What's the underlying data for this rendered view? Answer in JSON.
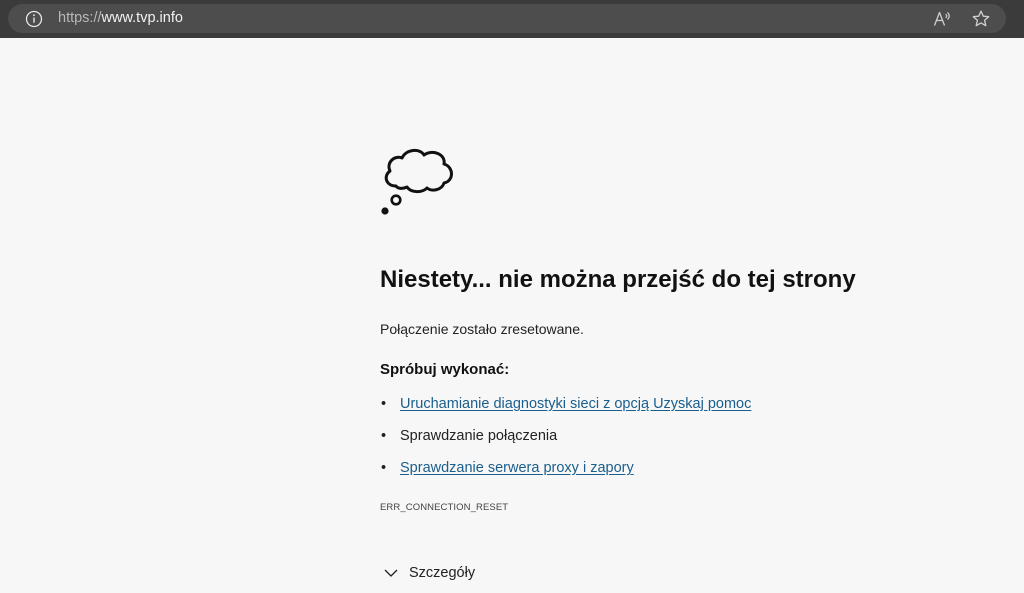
{
  "addressbar": {
    "url_scheme": "https://",
    "url_host": "www.tvp.info"
  },
  "error": {
    "title": "Niestety... nie można przejść do tej strony",
    "description": "Połączenie zostało zresetowane.",
    "suggest_heading": "Spróbuj wykonać:",
    "suggestions": [
      {
        "label": "Uruchamianie diagnostyki sieci z opcją Uzyskaj pomoc"
      },
      {
        "label": "Sprawdzanie połączenia"
      },
      {
        "label": "Sprawdzanie serwera proxy i zapory"
      }
    ],
    "code": "ERR_CONNECTION_RESET",
    "details_label": "Szczegóły"
  },
  "colors": {
    "link": "#1a5e8c",
    "toolbar": "#3b3b3b",
    "page_bg": "#f7f7f7"
  },
  "icons": [
    "info-icon",
    "read-aloud-icon",
    "favorite-icon",
    "cloud-icon",
    "chevron-down-icon"
  ]
}
